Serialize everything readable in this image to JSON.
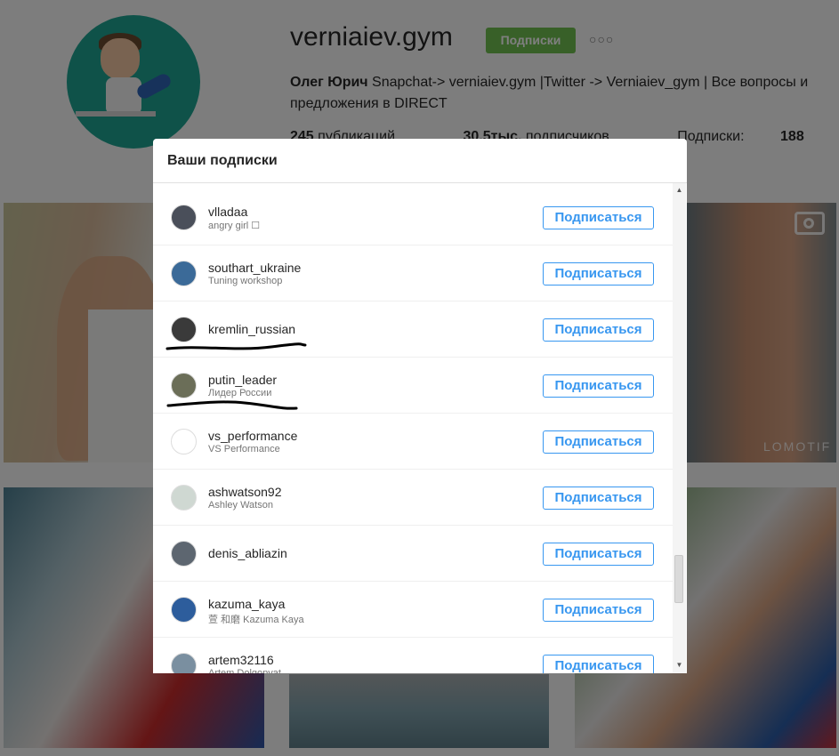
{
  "profile": {
    "username": "verniaiev.gym",
    "follow_state_label": "Подписки",
    "more_label": "○○○",
    "full_name": "Олег Юрич",
    "bio_text": "Snapchat-> verniaiev.gym |Twitter -> Verniaiev_gym | Все вопросы и предложения в DIRECT",
    "stats": {
      "posts_count": "245",
      "posts_label": "публикаций",
      "followers_count": "30,5тыс.",
      "followers_label": "подписчиков",
      "following_label": "Подписки:",
      "following_count": "188"
    },
    "watermark": "LOMOTIF"
  },
  "modal": {
    "title": "Ваши подписки",
    "follow_button_label": "Подписаться",
    "items": [
      {
        "username": "vlladaa",
        "full_name": "angry girl ☐",
        "avatar_color": "#4a4f5a"
      },
      {
        "username": "southart_ukraine",
        "full_name": "Tuning workshop",
        "avatar_color": "#3b6a98"
      },
      {
        "username": "kremlin_russian",
        "full_name": "",
        "avatar_color": "#3a3a3a"
      },
      {
        "username": "putin_leader",
        "full_name": "Лидер России",
        "avatar_color": "#6b6e58"
      },
      {
        "username": "vs_performance",
        "full_name": "VS Performance",
        "avatar_color": "#ffffff"
      },
      {
        "username": "ashwatson92",
        "full_name": "Ashley Watson",
        "avatar_color": "#cfd8d2"
      },
      {
        "username": "denis_abliazin",
        "full_name": "",
        "avatar_color": "#5d6670"
      },
      {
        "username": "kazuma_kaya",
        "full_name": "萱 和磨 Kazuma Kaya",
        "avatar_color": "#2d5d9c"
      },
      {
        "username": "artem32116",
        "full_name": "Artem Dolgopyat",
        "avatar_color": "#7a8fa0"
      }
    ]
  },
  "colors": {
    "accent_blue": "#3897f0",
    "following_green": "#70c050",
    "overlay": "rgba(0,0,0,0.5)"
  }
}
